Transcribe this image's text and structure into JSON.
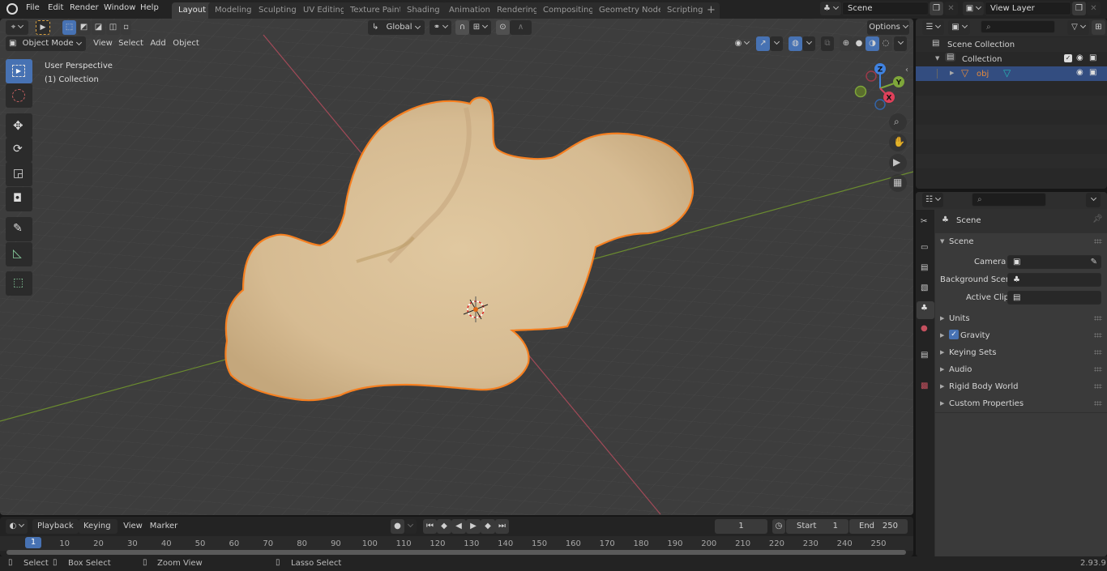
{
  "app": {
    "version": "2.93.9"
  },
  "topbar": {
    "menus": [
      "File",
      "Edit",
      "Render",
      "Window",
      "Help"
    ],
    "workspace_tabs": [
      {
        "label": "Layout",
        "active": true
      },
      {
        "label": "Modeling",
        "active": false
      },
      {
        "label": "Sculpting",
        "active": false
      },
      {
        "label": "UV Editing",
        "active": false
      },
      {
        "label": "Texture Paint",
        "active": false
      },
      {
        "label": "Shading",
        "active": false
      },
      {
        "label": "Animation",
        "active": false
      },
      {
        "label": "Rendering",
        "active": false
      },
      {
        "label": "Compositing",
        "active": false
      },
      {
        "label": "Geometry Nodes",
        "active": false
      },
      {
        "label": "Scripting",
        "active": false
      }
    ],
    "add_workspace_label": "+",
    "scene_name": "Scene",
    "view_layer_name": "View Layer"
  },
  "viewport_header": {
    "mode": "Object Mode",
    "menus": [
      "View",
      "Select",
      "Add",
      "Object"
    ],
    "transform_orientation": "Global",
    "options_label": "Options"
  },
  "viewport": {
    "perspective_label": "User Perspective",
    "collection_label": "(1) Collection",
    "gizmo_axes": [
      "X",
      "Y",
      "Z"
    ],
    "colors": {
      "selection_outline": "#f57f20",
      "x_axis": "#d0455f",
      "y_axis": "#7ea63a",
      "z_axis": "#3f82e0",
      "mesh": "#dcc29a"
    },
    "tools": [
      "select-box",
      "cursor",
      "move",
      "rotate",
      "scale",
      "transform",
      "annotate",
      "measure",
      "add-cube"
    ],
    "nav_buttons": [
      "zoom",
      "pan",
      "camera",
      "perspective-toggle"
    ]
  },
  "outliner": {
    "search_placeholder": "",
    "rows": [
      {
        "label": "Scene Collection",
        "type": "scene-collection"
      },
      {
        "label": "Collection",
        "type": "collection",
        "checked": true
      },
      {
        "label": "obj",
        "type": "mesh-object",
        "selected": true
      }
    ]
  },
  "properties": {
    "search_placeholder": "",
    "context_label": "Scene",
    "section_title": "Scene",
    "fields": [
      {
        "label": "Camera",
        "value": ""
      },
      {
        "label": "Background Scene",
        "value": ""
      },
      {
        "label": "Active Clip",
        "value": ""
      }
    ],
    "panels": [
      {
        "label": "Units",
        "checkbox": false
      },
      {
        "label": "Gravity",
        "checkbox": true,
        "checked": true
      },
      {
        "label": "Keying Sets",
        "checkbox": false
      },
      {
        "label": "Audio",
        "checkbox": false
      },
      {
        "label": "Rigid Body World",
        "checkbox": false
      },
      {
        "label": "Custom Properties",
        "checkbox": false
      }
    ],
    "tabs": [
      "tool",
      "render",
      "output",
      "view-layer",
      "scene",
      "world",
      "collection",
      "texture"
    ],
    "active_tab": "scene"
  },
  "timeline": {
    "menus": {
      "playback": "Playback",
      "keying": "Keying",
      "view": "View",
      "marker": "Marker"
    },
    "current_frame": "1",
    "start_label": "Start",
    "start_value": "1",
    "end_label": "End",
    "end_value": "250",
    "ticks": [
      "10",
      "20",
      "30",
      "40",
      "50",
      "60",
      "70",
      "80",
      "90",
      "100",
      "110",
      "120",
      "130",
      "140",
      "150",
      "160",
      "170",
      "180",
      "190",
      "200",
      "210",
      "220",
      "230",
      "240",
      "250"
    ],
    "playhead_label": "1"
  },
  "statusbar": {
    "hints": [
      {
        "label": "Select"
      },
      {
        "label": "Box Select"
      },
      {
        "label": "Zoom View"
      },
      {
        "label": "Lasso Select"
      }
    ]
  }
}
